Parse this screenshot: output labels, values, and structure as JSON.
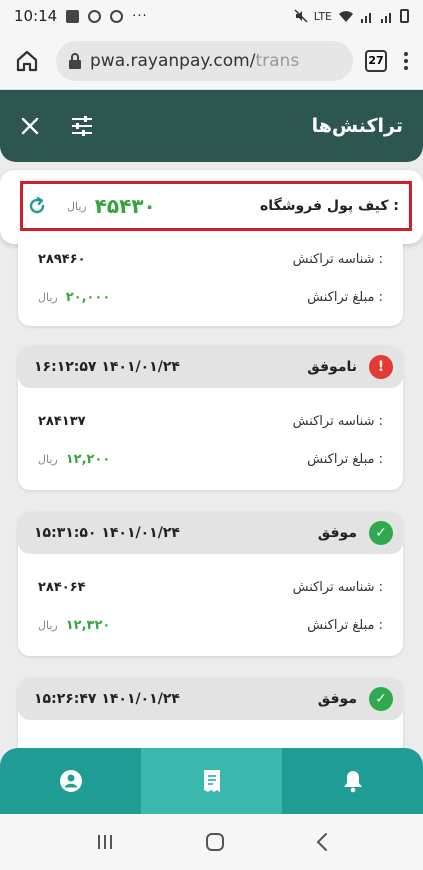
{
  "status_bar": {
    "time": "10:14",
    "network": "LTE"
  },
  "browser": {
    "url": "pwa.rayanpay.com/",
    "url_dim": "trans",
    "tab_count": "27"
  },
  "header": {
    "title": "تراکنش‌ها"
  },
  "wallet": {
    "label": "کیف پول فروشگاه :",
    "amount": "۴۵۴۳۰",
    "unit": "ریال"
  },
  "labels": {
    "tx_id": "شناسه تراکنش :",
    "tx_amount": "مبلغ تراکنش :",
    "unit": "ریال"
  },
  "transactions": [
    {
      "id": "۲۸۹۴۶۰",
      "amount": "۲۰,۰۰۰"
    },
    {
      "status": "ناموفق",
      "status_type": "error",
      "datetime": "۱۶:۱۲:۵۷ ۱۴۰۱/۰۱/۲۴",
      "id": "۲۸۴۱۳۷",
      "amount": "۱۲,۲۰۰"
    },
    {
      "status": "موفق",
      "status_type": "success",
      "datetime": "۱۵:۳۱:۵۰ ۱۴۰۱/۰۱/۲۴",
      "id": "۲۸۴۰۶۴",
      "amount": "۱۲,۳۲۰"
    },
    {
      "status": "موفق",
      "status_type": "success",
      "datetime": "۱۵:۲۶:۴۷ ۱۴۰۱/۰۱/۲۴"
    }
  ],
  "colors": {
    "header": "#2e5650",
    "nav": "#1f9c94",
    "nav_active": "#3bb8ae",
    "amount": "#36a53c",
    "success": "#2fa84f",
    "error": "#e53935",
    "highlight": "#d11d2a"
  }
}
